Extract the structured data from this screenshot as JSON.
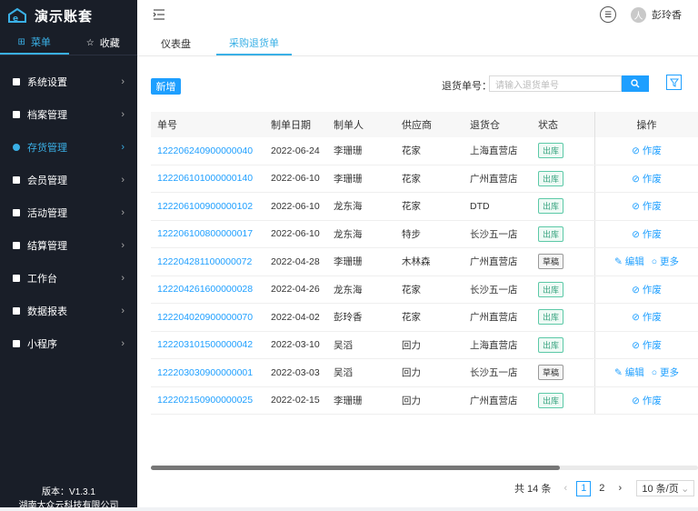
{
  "app": {
    "title": "演示账套",
    "logo_icon": "logo-icon"
  },
  "sidebar": {
    "tabs": [
      {
        "label": "菜单",
        "icon": "grid-icon"
      },
      {
        "label": "收藏",
        "icon": "star-icon"
      }
    ],
    "items": [
      {
        "label": "系统设置"
      },
      {
        "label": "档案管理"
      },
      {
        "label": "存货管理"
      },
      {
        "label": "会员管理"
      },
      {
        "label": "活动管理"
      },
      {
        "label": "结算管理"
      },
      {
        "label": "工作台"
      },
      {
        "label": "数据报表"
      },
      {
        "label": "小程序"
      }
    ],
    "version": "版本：V1.3.1",
    "company": "湖南大众云科技有限公司"
  },
  "header": {
    "username": "彭玲香",
    "avatar_text": "人"
  },
  "page_tabs": [
    {
      "label": "仪表盘"
    },
    {
      "label": "采购退货单"
    }
  ],
  "toolbar": {
    "add_label": "新增",
    "search_label": "退货单号：",
    "search_placeholder": "请输入退货单号"
  },
  "table": {
    "headers": [
      "单号",
      "制单日期",
      "制单人",
      "供应商",
      "退货仓",
      "状态",
      "操作"
    ],
    "rows": [
      {
        "no": "122206240900000040",
        "date": "2022-06-24",
        "maker": "李珊珊",
        "supplier": "花家",
        "warehouse": "上海直营店",
        "status": "出库",
        "ops": [
          "作废"
        ]
      },
      {
        "no": "122206101000000140",
        "date": "2022-06-10",
        "maker": "李珊珊",
        "supplier": "花家",
        "warehouse": "广州直营店",
        "status": "出库",
        "ops": [
          "作废"
        ]
      },
      {
        "no": "122206100900000102",
        "date": "2022-06-10",
        "maker": "龙东海",
        "supplier": "花家",
        "warehouse": "DTD",
        "status": "出库",
        "ops": [
          "作废"
        ]
      },
      {
        "no": "122206100800000017",
        "date": "2022-06-10",
        "maker": "龙东海",
        "supplier": "特步",
        "warehouse": "长沙五一店",
        "status": "出库",
        "ops": [
          "作废"
        ]
      },
      {
        "no": "122204281100000072",
        "date": "2022-04-28",
        "maker": "李珊珊",
        "supplier": "木林森",
        "warehouse": "广州直营店",
        "status": "草稿",
        "ops": [
          "编辑",
          "更多"
        ]
      },
      {
        "no": "122204261600000028",
        "date": "2022-04-26",
        "maker": "龙东海",
        "supplier": "花家",
        "warehouse": "长沙五一店",
        "status": "出库",
        "ops": [
          "作废"
        ]
      },
      {
        "no": "122204020900000070",
        "date": "2022-04-02",
        "maker": "彭玲香",
        "supplier": "花家",
        "warehouse": "广州直营店",
        "status": "出库",
        "ops": [
          "作废"
        ]
      },
      {
        "no": "122203101500000042",
        "date": "2022-03-10",
        "maker": "吴滔",
        "supplier": "回力",
        "warehouse": "上海直营店",
        "status": "出库",
        "ops": [
          "作废"
        ]
      },
      {
        "no": "122203030900000001",
        "date": "2022-03-03",
        "maker": "吴滔",
        "supplier": "回力",
        "warehouse": "长沙五一店",
        "status": "草稿",
        "ops": [
          "编辑",
          "更多"
        ]
      },
      {
        "no": "122202150900000025",
        "date": "2022-02-15",
        "maker": "李珊珊",
        "supplier": "回力",
        "warehouse": "广州直营店",
        "status": "出库",
        "ops": [
          "作废"
        ]
      }
    ]
  },
  "pagination": {
    "total": "共 14 条",
    "pages": [
      "1",
      "2"
    ],
    "current": "1",
    "page_size": "10 条/页"
  },
  "colors": {
    "accent": "#1e9fff",
    "sidebar_bg": "#191e28",
    "sidebar_active": "#3ab0e6"
  }
}
